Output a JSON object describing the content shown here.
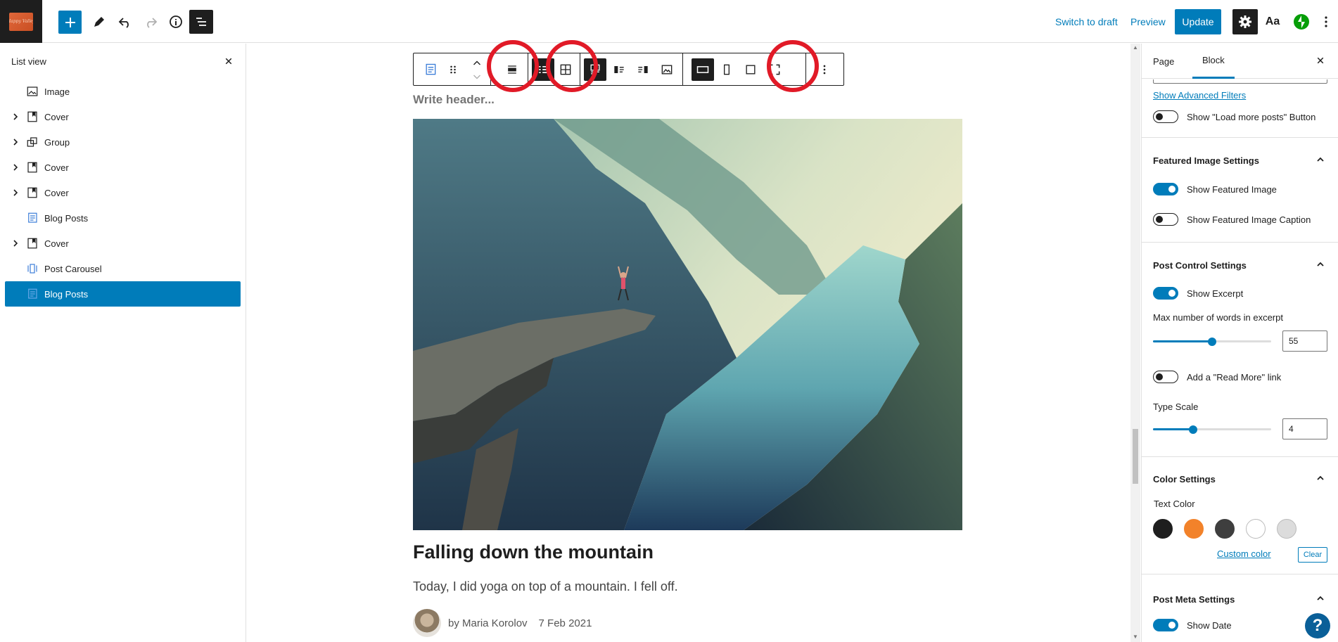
{
  "topbar": {
    "logo_text": "Happy Valley",
    "switch_to_draft": "Switch to draft",
    "preview": "Preview",
    "update": "Update",
    "typography_label": "Aa"
  },
  "list_view": {
    "title": "List view",
    "items": [
      {
        "label": "Image",
        "icon": "image-icon",
        "expandable": false
      },
      {
        "label": "Cover",
        "icon": "cover-icon",
        "expandable": true
      },
      {
        "label": "Group",
        "icon": "group-icon",
        "expandable": true
      },
      {
        "label": "Cover",
        "icon": "cover-icon",
        "expandable": true
      },
      {
        "label": "Cover",
        "icon": "cover-icon",
        "expandable": true
      },
      {
        "label": "Blog Posts",
        "icon": "blog-posts-icon",
        "expandable": false
      },
      {
        "label": "Cover",
        "icon": "cover-icon",
        "expandable": true
      },
      {
        "label": "Post Carousel",
        "icon": "post-carousel-icon",
        "expandable": false
      },
      {
        "label": "Blog Posts",
        "icon": "blog-posts-icon",
        "expandable": false,
        "selected": true
      }
    ]
  },
  "canvas": {
    "write_header_placeholder": "Write header...",
    "post_title": "Falling down the mountain",
    "post_excerpt": "Today, I did yoga on top of a mountain. I fell off.",
    "post_author": "by Maria Korolov",
    "post_date": "7 Feb 2021"
  },
  "settings": {
    "tabs": {
      "page": "Page",
      "block": "Block"
    },
    "show_advanced_filters": "Show Advanced Filters",
    "load_more_label": "Show \"Load more posts\" Button",
    "load_more_on": false,
    "featured_image": {
      "title": "Featured Image Settings",
      "show_featured_image": "Show Featured Image",
      "show_featured_image_on": true,
      "show_caption": "Show Featured Image Caption",
      "show_caption_on": false
    },
    "post_control": {
      "title": "Post Control Settings",
      "show_excerpt": "Show Excerpt",
      "show_excerpt_on": true,
      "max_words_label": "Max number of words in excerpt",
      "max_words_value": "55",
      "max_words_fraction": 0.5,
      "read_more_label": "Add a \"Read More\" link",
      "read_more_on": false,
      "type_scale_label": "Type Scale",
      "type_scale_value": "4",
      "type_scale_fraction": 0.34
    },
    "color": {
      "title": "Color Settings",
      "text_color_label": "Text Color",
      "swatches": [
        "#1e1e1e",
        "#f2822a",
        "#3e3e3e",
        "#ffffff",
        "#dcdcdc"
      ],
      "custom_color": "Custom color",
      "clear": "Clear"
    },
    "post_meta": {
      "title": "Post Meta Settings",
      "show_date": "Show Date",
      "show_date_on": true
    }
  },
  "colors": {
    "accent": "#007cba",
    "highlight_circle": "#e11a27"
  }
}
